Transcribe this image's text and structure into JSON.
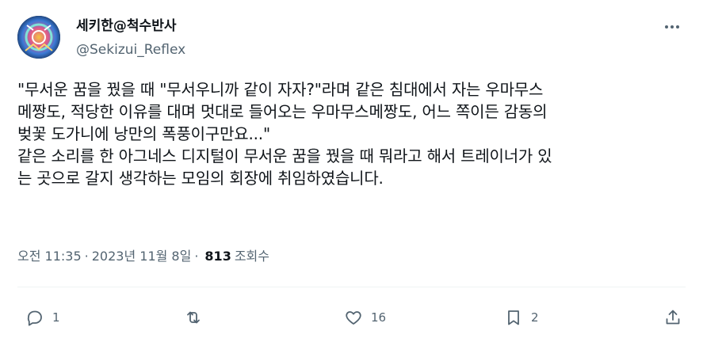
{
  "author": {
    "display_name": "세키한@척수반사",
    "handle": "@Sekizui_Reflex"
  },
  "tweet": {
    "text": "\"무서운 꿈을 꿨을 때 \"무서우니까 같이 자자?\"라며 같은 침대에서 자는 우마무스\n메짱도, 적당한 이유를 대며 멋대로 들어오는 우마무스메짱도, 어느 쪽이든 감동의\n벚꽃 도가니에 낭만의 폭풍이구만요...\"\n같은 소리를 한 아그네스 디지털이 무서운 꿈을 꿨을 때 뭐라고 해서 트레이너가 있\n는 곳으로 갈지 생각하는 모임의 회장에 취임하였습니다."
  },
  "meta": {
    "time": "오전 11:35",
    "separator": "·",
    "date": "2023년 11월 8일",
    "separator2": "·",
    "views_count": "813",
    "views_label": "조회수"
  },
  "actions": {
    "reply_count": "1",
    "like_count": "16",
    "bookmark_count": "2"
  },
  "icons": {
    "more": "more-horizontal-icon",
    "reply": "reply-icon",
    "retweet": "retweet-icon",
    "like": "heart-icon",
    "bookmark": "bookmark-icon",
    "share": "share-icon"
  },
  "colors": {
    "text": "#0f1419",
    "secondary": "#536471",
    "divider": "#eff3f4"
  }
}
